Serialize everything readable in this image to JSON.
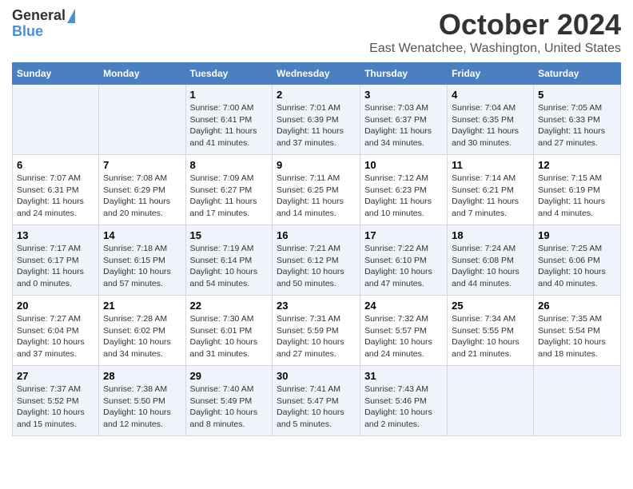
{
  "logo": {
    "line1": "General",
    "line2": "Blue"
  },
  "title": "October 2024",
  "location": "East Wenatchee, Washington, United States",
  "weekdays": [
    "Sunday",
    "Monday",
    "Tuesday",
    "Wednesday",
    "Thursday",
    "Friday",
    "Saturday"
  ],
  "weeks": [
    [
      {
        "day": null,
        "info": null
      },
      {
        "day": null,
        "info": null
      },
      {
        "day": "1",
        "sunrise": "Sunrise: 7:00 AM",
        "sunset": "Sunset: 6:41 PM",
        "daylight": "Daylight: 11 hours and 41 minutes."
      },
      {
        "day": "2",
        "sunrise": "Sunrise: 7:01 AM",
        "sunset": "Sunset: 6:39 PM",
        "daylight": "Daylight: 11 hours and 37 minutes."
      },
      {
        "day": "3",
        "sunrise": "Sunrise: 7:03 AM",
        "sunset": "Sunset: 6:37 PM",
        "daylight": "Daylight: 11 hours and 34 minutes."
      },
      {
        "day": "4",
        "sunrise": "Sunrise: 7:04 AM",
        "sunset": "Sunset: 6:35 PM",
        "daylight": "Daylight: 11 hours and 30 minutes."
      },
      {
        "day": "5",
        "sunrise": "Sunrise: 7:05 AM",
        "sunset": "Sunset: 6:33 PM",
        "daylight": "Daylight: 11 hours and 27 minutes."
      }
    ],
    [
      {
        "day": "6",
        "sunrise": "Sunrise: 7:07 AM",
        "sunset": "Sunset: 6:31 PM",
        "daylight": "Daylight: 11 hours and 24 minutes."
      },
      {
        "day": "7",
        "sunrise": "Sunrise: 7:08 AM",
        "sunset": "Sunset: 6:29 PM",
        "daylight": "Daylight: 11 hours and 20 minutes."
      },
      {
        "day": "8",
        "sunrise": "Sunrise: 7:09 AM",
        "sunset": "Sunset: 6:27 PM",
        "daylight": "Daylight: 11 hours and 17 minutes."
      },
      {
        "day": "9",
        "sunrise": "Sunrise: 7:11 AM",
        "sunset": "Sunset: 6:25 PM",
        "daylight": "Daylight: 11 hours and 14 minutes."
      },
      {
        "day": "10",
        "sunrise": "Sunrise: 7:12 AM",
        "sunset": "Sunset: 6:23 PM",
        "daylight": "Daylight: 11 hours and 10 minutes."
      },
      {
        "day": "11",
        "sunrise": "Sunrise: 7:14 AM",
        "sunset": "Sunset: 6:21 PM",
        "daylight": "Daylight: 11 hours and 7 minutes."
      },
      {
        "day": "12",
        "sunrise": "Sunrise: 7:15 AM",
        "sunset": "Sunset: 6:19 PM",
        "daylight": "Daylight: 11 hours and 4 minutes."
      }
    ],
    [
      {
        "day": "13",
        "sunrise": "Sunrise: 7:17 AM",
        "sunset": "Sunset: 6:17 PM",
        "daylight": "Daylight: 11 hours and 0 minutes."
      },
      {
        "day": "14",
        "sunrise": "Sunrise: 7:18 AM",
        "sunset": "Sunset: 6:15 PM",
        "daylight": "Daylight: 10 hours and 57 minutes."
      },
      {
        "day": "15",
        "sunrise": "Sunrise: 7:19 AM",
        "sunset": "Sunset: 6:14 PM",
        "daylight": "Daylight: 10 hours and 54 minutes."
      },
      {
        "day": "16",
        "sunrise": "Sunrise: 7:21 AM",
        "sunset": "Sunset: 6:12 PM",
        "daylight": "Daylight: 10 hours and 50 minutes."
      },
      {
        "day": "17",
        "sunrise": "Sunrise: 7:22 AM",
        "sunset": "Sunset: 6:10 PM",
        "daylight": "Daylight: 10 hours and 47 minutes."
      },
      {
        "day": "18",
        "sunrise": "Sunrise: 7:24 AM",
        "sunset": "Sunset: 6:08 PM",
        "daylight": "Daylight: 10 hours and 44 minutes."
      },
      {
        "day": "19",
        "sunrise": "Sunrise: 7:25 AM",
        "sunset": "Sunset: 6:06 PM",
        "daylight": "Daylight: 10 hours and 40 minutes."
      }
    ],
    [
      {
        "day": "20",
        "sunrise": "Sunrise: 7:27 AM",
        "sunset": "Sunset: 6:04 PM",
        "daylight": "Daylight: 10 hours and 37 minutes."
      },
      {
        "day": "21",
        "sunrise": "Sunrise: 7:28 AM",
        "sunset": "Sunset: 6:02 PM",
        "daylight": "Daylight: 10 hours and 34 minutes."
      },
      {
        "day": "22",
        "sunrise": "Sunrise: 7:30 AM",
        "sunset": "Sunset: 6:01 PM",
        "daylight": "Daylight: 10 hours and 31 minutes."
      },
      {
        "day": "23",
        "sunrise": "Sunrise: 7:31 AM",
        "sunset": "Sunset: 5:59 PM",
        "daylight": "Daylight: 10 hours and 27 minutes."
      },
      {
        "day": "24",
        "sunrise": "Sunrise: 7:32 AM",
        "sunset": "Sunset: 5:57 PM",
        "daylight": "Daylight: 10 hours and 24 minutes."
      },
      {
        "day": "25",
        "sunrise": "Sunrise: 7:34 AM",
        "sunset": "Sunset: 5:55 PM",
        "daylight": "Daylight: 10 hours and 21 minutes."
      },
      {
        "day": "26",
        "sunrise": "Sunrise: 7:35 AM",
        "sunset": "Sunset: 5:54 PM",
        "daylight": "Daylight: 10 hours and 18 minutes."
      }
    ],
    [
      {
        "day": "27",
        "sunrise": "Sunrise: 7:37 AM",
        "sunset": "Sunset: 5:52 PM",
        "daylight": "Daylight: 10 hours and 15 minutes."
      },
      {
        "day": "28",
        "sunrise": "Sunrise: 7:38 AM",
        "sunset": "Sunset: 5:50 PM",
        "daylight": "Daylight: 10 hours and 12 minutes."
      },
      {
        "day": "29",
        "sunrise": "Sunrise: 7:40 AM",
        "sunset": "Sunset: 5:49 PM",
        "daylight": "Daylight: 10 hours and 8 minutes."
      },
      {
        "day": "30",
        "sunrise": "Sunrise: 7:41 AM",
        "sunset": "Sunset: 5:47 PM",
        "daylight": "Daylight: 10 hours and 5 minutes."
      },
      {
        "day": "31",
        "sunrise": "Sunrise: 7:43 AM",
        "sunset": "Sunset: 5:46 PM",
        "daylight": "Daylight: 10 hours and 2 minutes."
      },
      {
        "day": null,
        "info": null
      },
      {
        "day": null,
        "info": null
      }
    ]
  ]
}
